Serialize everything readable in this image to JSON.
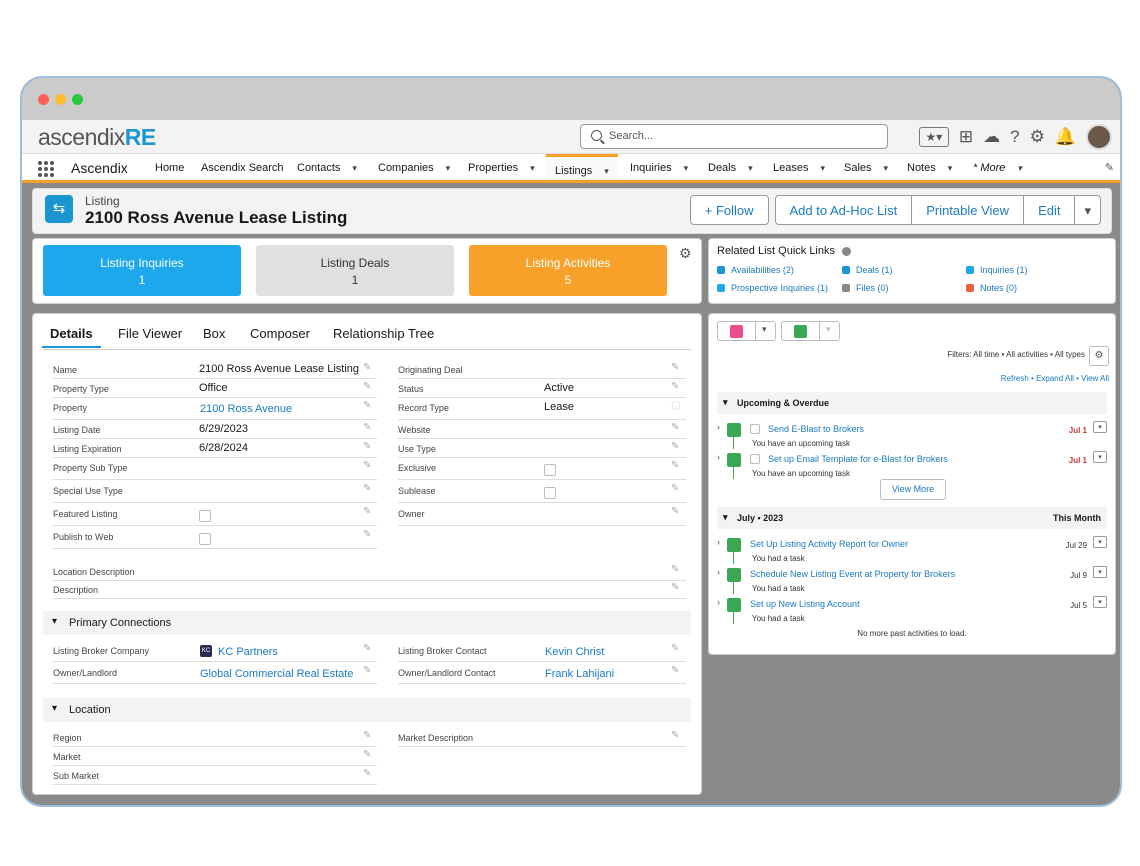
{
  "app": {
    "logo_text": "ascendix",
    "logo_bold": "RE",
    "name": "Ascendix"
  },
  "search": {
    "placeholder": "Search..."
  },
  "nav": {
    "items": [
      "Home",
      "Ascendix Search",
      "Contacts",
      "Companies",
      "Properties",
      "Listings",
      "Inquiries",
      "Deals",
      "Leases",
      "Sales",
      "Notes",
      "* More"
    ],
    "active": "Listings"
  },
  "record": {
    "type": "Listing",
    "title": "2100 Ross Avenue Lease Listing",
    "buttons": {
      "follow": "Follow",
      "adhoc": "Add to Ad-Hoc List",
      "printable": "Printable View",
      "edit": "Edit"
    }
  },
  "tiles": [
    {
      "label": "Listing Inquiries",
      "count": "1",
      "color": "#1da8ec"
    },
    {
      "label": "Listing Deals",
      "count": "1",
      "color": "#e0e0e0"
    },
    {
      "label": "Listing Activities",
      "count": "5",
      "color": "#f8a12a"
    }
  ],
  "quick_links": {
    "title": "Related List Quick Links",
    "links": [
      "Availabilities (2)",
      "Deals (1)",
      "Inquiries (1)",
      "Prospective Inquiries (1)",
      "Files (0)",
      "Notes (0)"
    ]
  },
  "detail_tabs": [
    "Details",
    "File Viewer",
    "Box",
    "Composer",
    "Relationship Tree"
  ],
  "fields_left": [
    {
      "label": "Name",
      "value": "2100 Ross Avenue Lease Listing"
    },
    {
      "label": "Property Type",
      "value": "Office"
    },
    {
      "label": "Property",
      "value": "2100 Ross Avenue"
    },
    {
      "label": "Listing Date",
      "value": "6/29/2023"
    },
    {
      "label": "Listing Expiration",
      "value": "6/28/2024"
    },
    {
      "label": "Property Sub Type",
      "value": ""
    },
    {
      "label": "Special Use Type",
      "value": ""
    },
    {
      "label": "Featured Listing",
      "value": ""
    },
    {
      "label": "Publish to Web",
      "value": ""
    }
  ],
  "fields_right": [
    {
      "label": "Originating Deal",
      "value": ""
    },
    {
      "label": "Status",
      "value": "Active"
    },
    {
      "label": "Record Type",
      "value": "Lease"
    },
    {
      "label": "Website",
      "value": ""
    },
    {
      "label": "Use Type",
      "value": ""
    },
    {
      "label": "Exclusive",
      "value": ""
    },
    {
      "label": "Sublease",
      "value": ""
    },
    {
      "label": "Owner",
      "value": ""
    }
  ],
  "fields_wide": [
    {
      "label": "Location Description"
    },
    {
      "label": "Description"
    }
  ],
  "primary_connections": {
    "title": "Primary Connections",
    "listing_broker_company_label": "Listing Broker Company",
    "listing_broker_company": "KC Partners",
    "kc_badge": "KC",
    "owner_landlord_label": "Owner/Landlord",
    "owner_landlord": "Global Commercial Real Estate",
    "listing_broker_contact_label": "Listing Broker Contact",
    "listing_broker_contact": "Kevin Christ",
    "owner_landlord_contact_label": "Owner/Landlord Contact",
    "owner_landlord_contact": "Frank Lahijani"
  },
  "location": {
    "title": "Location",
    "region_label": "Region",
    "market_label": "Market",
    "sub_market_label": "Sub Market",
    "market_description_label": "Market Description"
  },
  "activity": {
    "filters": "Filters: All time • All activities • All types",
    "refresh": "Refresh",
    "expand_all": "Expand All",
    "view_all": "View All",
    "upcoming_title": "Upcoming & Overdue",
    "upcoming": [
      {
        "title": "Send E-Blast to Brokers",
        "sub": "You have an upcoming task",
        "date": "Jul 1"
      },
      {
        "title": "Set up Email Template for e-Blast for Brokers",
        "sub": "You have an upcoming task",
        "date": "Jul 1"
      }
    ],
    "view_more": "View More",
    "month_title": "July • 2023",
    "month_right": "This Month",
    "past": [
      {
        "title": "Set Up Listing Activity Report for Owner",
        "sub": "You had a task",
        "date": "Jul 29"
      },
      {
        "title": "Schedule New Listing Event at Property for Brokers",
        "sub": "You had a task",
        "date": "Jul 9"
      },
      {
        "title": "Set up New Listing Account",
        "sub": "You had a task",
        "date": "Jul 5"
      }
    ],
    "no_more": "No more past activities to load."
  },
  "colors": {
    "accent": "#1b96d1",
    "orange": "#f6a02e",
    "link": "#1b7ac2",
    "overdue": "#c23934",
    "task": "#3ba755"
  }
}
